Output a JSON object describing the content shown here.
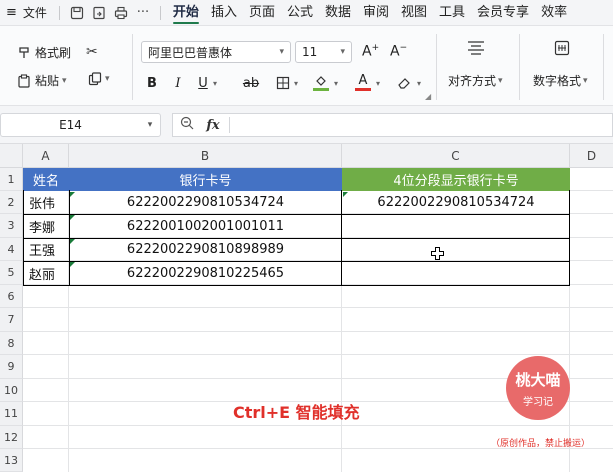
{
  "menubar": {
    "file_label": "文件",
    "tabs": [
      {
        "label": "开始",
        "active": true
      },
      {
        "label": "插入",
        "active": false
      },
      {
        "label": "页面",
        "active": false
      },
      {
        "label": "公式",
        "active": false
      },
      {
        "label": "数据",
        "active": false
      },
      {
        "label": "审阅",
        "active": false
      },
      {
        "label": "视图",
        "active": false
      },
      {
        "label": "工具",
        "active": false
      },
      {
        "label": "会员专享",
        "active": false
      },
      {
        "label": "效率",
        "active": false
      }
    ],
    "icons": [
      "menu-icon",
      "save-icon",
      "export-icon",
      "print-icon",
      "more-icon"
    ]
  },
  "ribbon": {
    "format_painter_label": "格式刷",
    "paste_label": "粘贴",
    "font_name": "阿里巴巴普惠体",
    "font_size": "11",
    "align_label": "对齐方式",
    "number_format_label": "数字格式",
    "increase_font_glyph": "A⁺",
    "decrease_font_glyph": "A⁻",
    "bold_glyph": "B",
    "italic_glyph": "I",
    "underline_glyph": "U",
    "strike_glyph": "ab"
  },
  "formula_bar": {
    "cell_ref": "E14",
    "fx_label": "fx",
    "formula": ""
  },
  "sheet": {
    "columns": [
      "A",
      "B",
      "C",
      "D"
    ],
    "rows": [
      "1",
      "2",
      "3",
      "4",
      "5",
      "6",
      "7",
      "8",
      "9",
      "10",
      "11",
      "12",
      "13"
    ],
    "header": {
      "name": "姓名",
      "card": "银行卡号",
      "segmented": "4位分段显示银行卡号"
    },
    "records": [
      {
        "name": "张伟",
        "card": "6222002290810534724",
        "segmented": "6222002290810534724"
      },
      {
        "name": "李娜",
        "card": "6222001002001001011",
        "segmented": ""
      },
      {
        "name": "王强",
        "card": "6222002290810898989",
        "segmented": ""
      },
      {
        "name": "赵丽",
        "card": "6222002290810225465",
        "segmented": ""
      }
    ]
  },
  "overlay": {
    "caption": "Ctrl+E 智能填充",
    "logo_line1": "桃大喵",
    "logo_line2": "学习记",
    "logo_sub": "（原创作品，禁止搬运）"
  },
  "colors": {
    "header_blue": "#4472c4",
    "header_green": "#70ad47",
    "active_tab_underline": "#1f7a4c",
    "caption_red": "#e0302a"
  }
}
